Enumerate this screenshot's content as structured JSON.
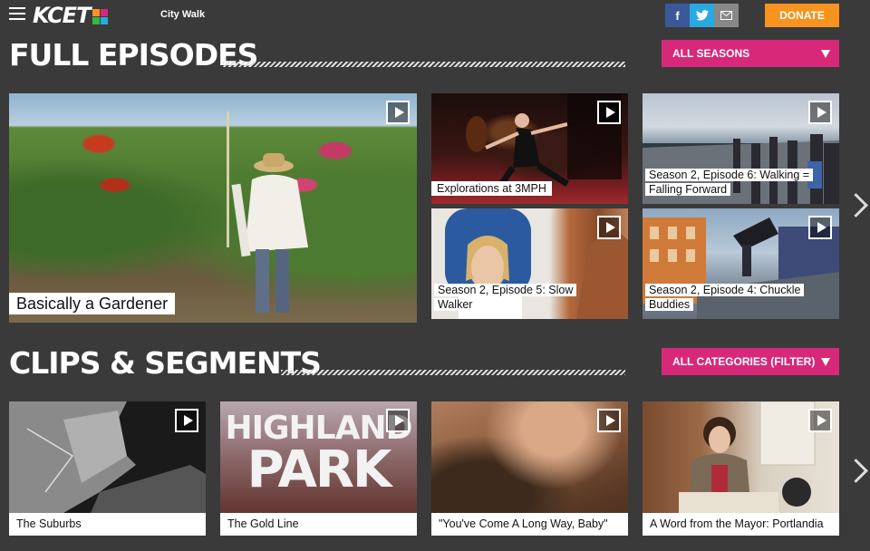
{
  "header": {
    "logo_text": "KCET",
    "site_name": "City Walk",
    "social": [
      {
        "label": "f",
        "icon": "facebook-icon",
        "color": "#3b5998"
      },
      {
        "label": "t",
        "icon": "twitter-icon",
        "color": "#2aa9e0"
      },
      {
        "label": "✉",
        "icon": "email-icon",
        "color": "#888888"
      }
    ],
    "donate_label": "DONATE"
  },
  "colors": {
    "accent_pink": "#d8287a",
    "donate_orange": "#f7931e",
    "background": "#3a3a3a"
  },
  "full_episodes": {
    "title": "FULL EPISODES",
    "filter_label": "ALL SEASONS",
    "featured": {
      "caption": "Basically a Gardener"
    },
    "tiles": [
      {
        "caption": "Explorations at 3MPH"
      },
      {
        "caption_lines": [
          "Season 2, Episode 6: Walking =",
          "Falling Forward"
        ]
      },
      {
        "caption_lines": [
          "Season 2, Episode 5: Slow",
          "Walker"
        ]
      },
      {
        "caption_lines": [
          "Season 2, Episode 4: Chuckle",
          "Buddies"
        ]
      }
    ]
  },
  "clips": {
    "title": "CLIPS & SEGMENTS",
    "filter_label": "ALL CATEGORIES (FILTER)",
    "highland_line1": "HIGHLAND",
    "highland_line2": "PARK",
    "tiles": [
      {
        "caption": "The Suburbs"
      },
      {
        "caption": "The Gold Line"
      },
      {
        "caption": "\"You've Come A Long Way, Baby\""
      },
      {
        "caption": "A Word from the Mayor: Portlandia"
      }
    ]
  }
}
